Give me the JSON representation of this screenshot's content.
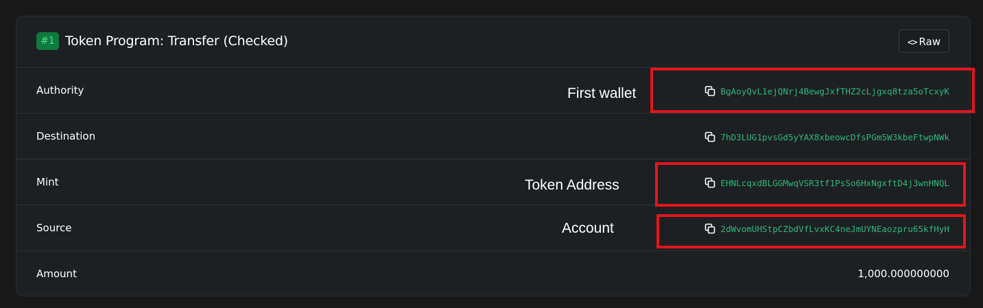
{
  "header": {
    "badge": "#1",
    "title": "Token Program: Transfer (Checked)",
    "raw_button_label": "Raw"
  },
  "rows": [
    {
      "label": "Authority",
      "value": "BgAoyQvL1ejQNrj4BewgJxfTHZ2cLjgxq8tza5oTcxyK",
      "annotation": "First wallet"
    },
    {
      "label": "Destination",
      "value": "7hD3LUG1pvsGd5yYAX8xbeowcDfsPGm5W3kbeFtwpNWk"
    },
    {
      "label": "Mint",
      "value": "EHNLcqxdBLGGMwqVSR3tf1PsSo6HxNgxftD4j3wnHNQL",
      "annotation": "Token Address"
    },
    {
      "label": "Source",
      "value": "2dWvomUHStpCZbdVfLvxKC4neJmUYNEaozpru65kfHyH",
      "annotation": "Account"
    },
    {
      "label": "Amount",
      "value": "1,000.000000000"
    }
  ],
  "colors": {
    "address": "#2fb67c",
    "badge_bg": "#0f7a3f",
    "badge_text": "#4ee38a",
    "highlight": "#e4151f"
  },
  "icons": {
    "copy": "copy-icon",
    "code": "code-icon"
  }
}
